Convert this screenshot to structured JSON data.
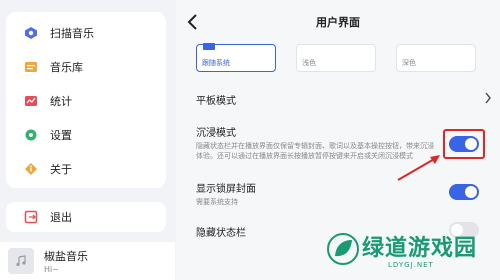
{
  "sidebar": {
    "items": [
      {
        "label": "扫描音乐",
        "icon": "scan-icon"
      },
      {
        "label": "音乐库",
        "icon": "music-library-icon"
      },
      {
        "label": "统计",
        "icon": "stats-icon"
      },
      {
        "label": "设置",
        "icon": "gear-icon"
      },
      {
        "label": "关于",
        "icon": "info-icon"
      }
    ],
    "exit": {
      "label": "退出",
      "icon": "exit-icon"
    }
  },
  "player": {
    "title": "椒盐音乐",
    "subtitle": "Hi~"
  },
  "header": {
    "title": "用户界面"
  },
  "theme": {
    "options": [
      "跟随系统",
      "浅色",
      "深色"
    ]
  },
  "settings": {
    "tablet_mode": {
      "title": "平板模式"
    },
    "immersive_mode": {
      "title": "沉浸模式",
      "description": "隐藏状态栏并在播放界面仅保留专辑封面、歌词以及基本操控按钮，带来沉浸体验。还可以通过在播放界面长按播放暂停按键来开启或关闭沉浸模式",
      "enabled": true
    },
    "lockscreen_cover": {
      "title": "显示锁屏封面",
      "description": "需要系统支持",
      "enabled": true
    },
    "hide_statusbar": {
      "title": "隐藏状态栏",
      "enabled": false
    }
  },
  "watermark": {
    "text": "绿道游戏园",
    "sub": "LDYGJ.NET"
  },
  "colors": {
    "accent": "#3a64e6",
    "highlight": "#e02525",
    "watermark": "#1a9a74"
  }
}
